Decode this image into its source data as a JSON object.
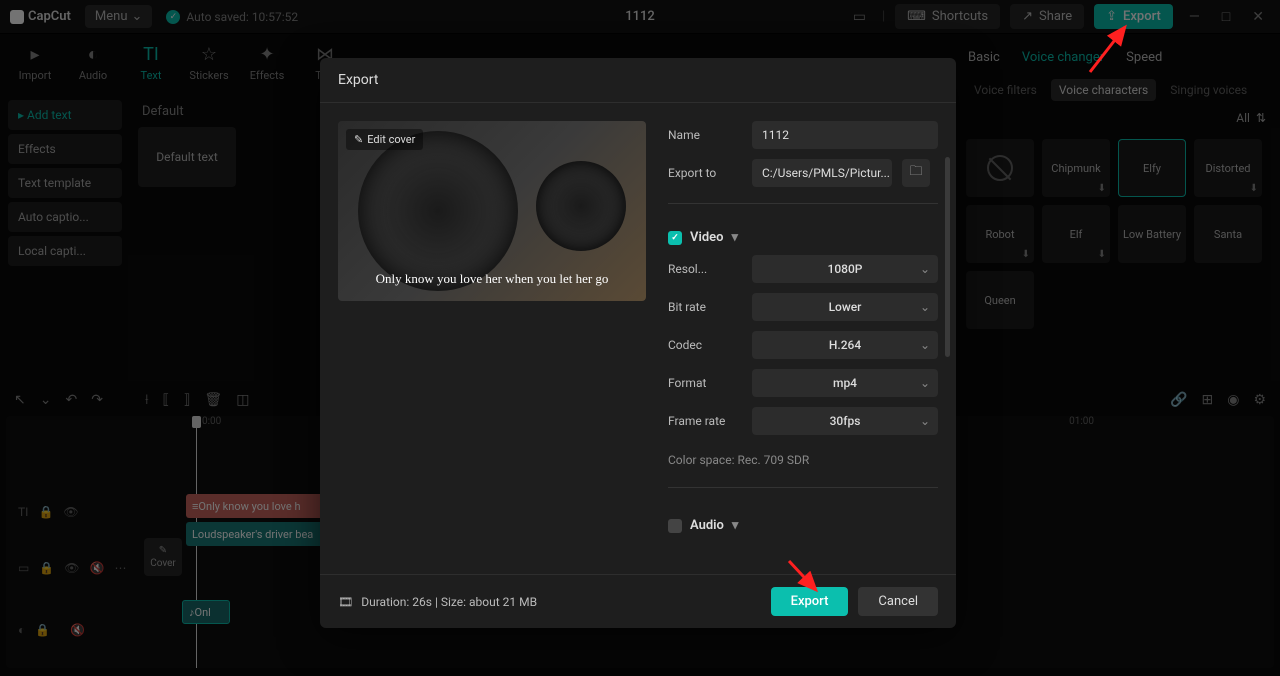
{
  "app": {
    "name": "CapCut",
    "menu": "Menu",
    "autosave": "Auto saved: 10:57:52",
    "project": "1112"
  },
  "top": {
    "shortcuts": "Shortcuts",
    "share": "Share",
    "export": "Export"
  },
  "tools": [
    "Import",
    "Audio",
    "Text",
    "Stickers",
    "Effects",
    "Trar"
  ],
  "side": {
    "addtext": "Add text",
    "effects": "Effects",
    "template": "Text template",
    "autocap": "Auto captio...",
    "localcap": "Local capti..."
  },
  "mid": {
    "default": "Default",
    "defaulttext": "Default text"
  },
  "player": "Player",
  "inspector": {
    "tabs": {
      "basic": "Basic",
      "voice": "Voice changer",
      "speed": "Speed"
    },
    "sub": {
      "filters": "Voice filters",
      "chars": "Voice characters",
      "singing": "Singing voices"
    },
    "all": "All",
    "voices": [
      "",
      "Chipmunk",
      "Elfy",
      "Distorted",
      "Robot",
      "Elf",
      "Low Battery",
      "Santa",
      "Queen"
    ]
  },
  "timeline": {
    "time0": "0:00",
    "time1": "01:00",
    "textclip": "Only know you love h",
    "videoclip": "Loudspeaker's driver bea",
    "audioclip": "Onl",
    "cover": "Cover"
  },
  "modal": {
    "title": "Export",
    "editcover": "Edit cover",
    "covertext": "Only know you love her when you let her go",
    "labels": {
      "name": "Name",
      "exportto": "Export to",
      "resol": "Resol...",
      "bitrate": "Bit rate",
      "codec": "Codec",
      "format": "Format",
      "framerate": "Frame rate"
    },
    "values": {
      "name": "1112",
      "path": "C:/Users/PMLS/Pictur...",
      "resol": "1080P",
      "bitrate": "Lower",
      "codec": "H.264",
      "format": "mp4",
      "framerate": "30fps"
    },
    "video": "Video",
    "audio": "Audio",
    "colorspace": "Color space: Rec. 709 SDR",
    "duration": "Duration: 26s | Size: about 21 MB",
    "export": "Export",
    "cancel": "Cancel"
  }
}
